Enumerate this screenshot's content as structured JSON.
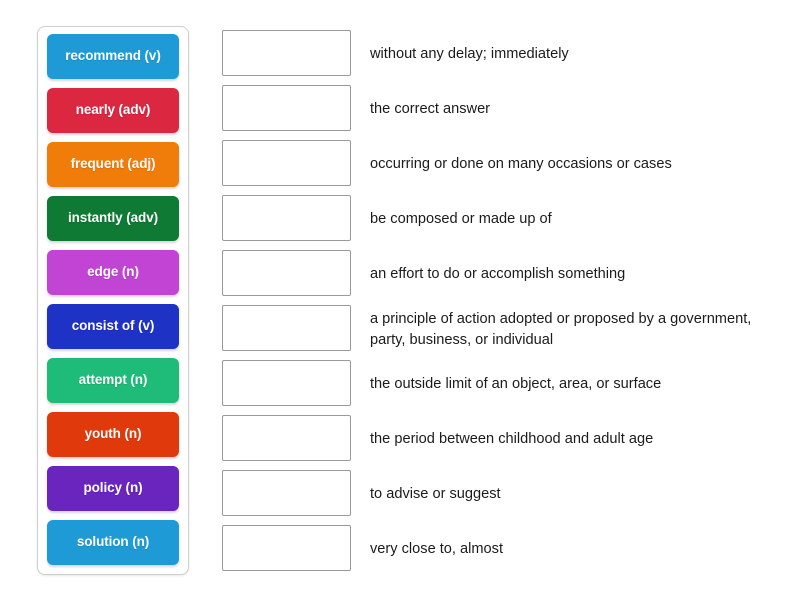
{
  "activity": {
    "type": "match-up",
    "tile_panel_name": "word-tiles-panel"
  },
  "tiles": [
    {
      "label": "recommend (v)",
      "color": "#1E9BD7"
    },
    {
      "label": "nearly (adv)",
      "color": "#DB2740"
    },
    {
      "label": "frequent (adj)",
      "color": "#F07C0A"
    },
    {
      "label": "instantly (adv)",
      "color": "#0E7A33"
    },
    {
      "label": "edge (n)",
      "color": "#C244D4"
    },
    {
      "label": "consist of (v)",
      "color": "#1E32C6"
    },
    {
      "label": "attempt (n)",
      "color": "#1EBC78"
    },
    {
      "label": "youth (n)",
      "color": "#E03A0C"
    },
    {
      "label": "policy (n)",
      "color": "#6A25BE"
    },
    {
      "label": "solution (n)",
      "color": "#1E9BD7"
    }
  ],
  "rows": [
    {
      "answer": "",
      "definition": "without any delay; immediately"
    },
    {
      "answer": "",
      "definition": "the correct answer"
    },
    {
      "answer": "",
      "definition": "occurring or done on many occasions or cases"
    },
    {
      "answer": "",
      "definition": "be composed or made up of"
    },
    {
      "answer": "",
      "definition": "an effort to do or accomplish something"
    },
    {
      "answer": "",
      "definition": "a principle of action adopted or proposed by a government, party, business, or individual"
    },
    {
      "answer": "",
      "definition": "the outside limit of an object, area, or surface"
    },
    {
      "answer": "",
      "definition": "the period between childhood and adult age"
    },
    {
      "answer": "",
      "definition": "to advise or suggest"
    },
    {
      "answer": "",
      "definition": "very close to, almost"
    }
  ],
  "colors": {
    "page_background": "#FFFFFF",
    "panel_border": "#CFCFCF",
    "dropzone_border": "#9A9A9A",
    "definition_text": "#1B1B1B",
    "tile_text": "#FFFFFF"
  }
}
